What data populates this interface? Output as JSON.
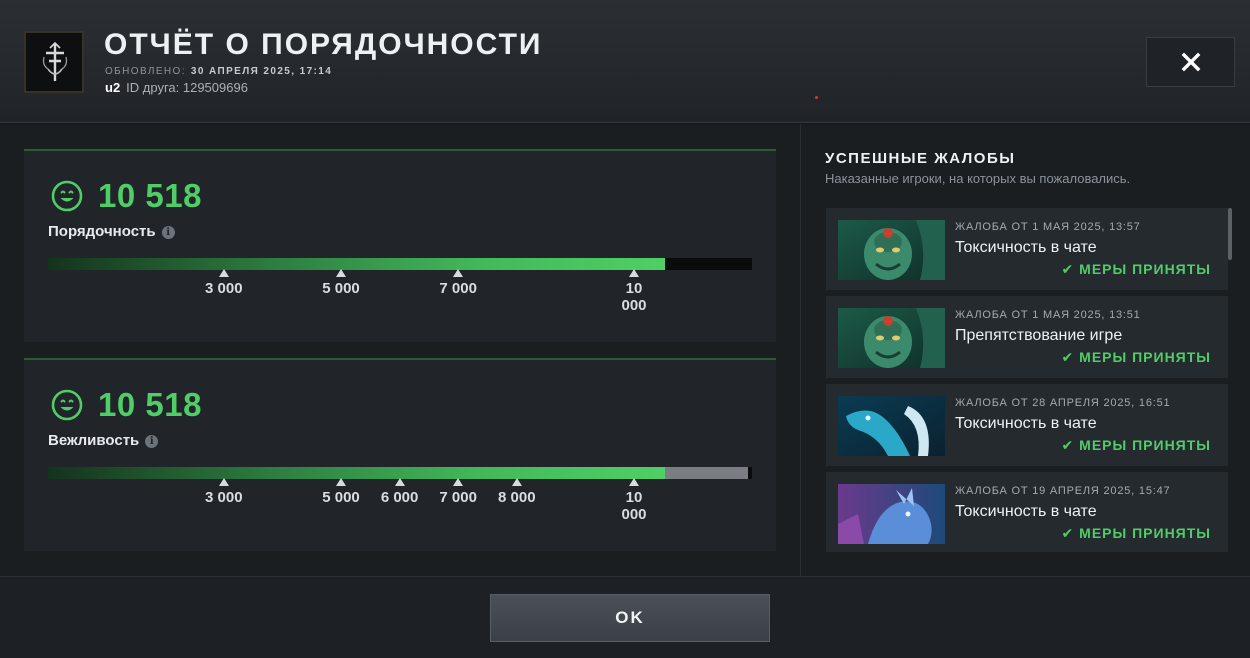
{
  "header": {
    "title": "ОТЧЁТ О ПОРЯДОЧНОСТИ",
    "updated_label": "ОБНОВЛЕНО:",
    "updated_date": "30 АПРЕЛЯ 2025, 17:14",
    "username": "u2",
    "friend_id": "ID друга: 129509696",
    "close_icon": "close-icon"
  },
  "cards": [
    {
      "score": "10 518",
      "label": "Порядочность",
      "info_icon": "i",
      "value": 10518,
      "fill_fraction": 0.876,
      "ticks": [
        {
          "label": "3 000",
          "value": 3000
        },
        {
          "label": "5 000",
          "value": 5000
        },
        {
          "label": "7 000",
          "value": 7000
        },
        {
          "label": "10 000",
          "value": 10000
        }
      ],
      "rest_color": "#0a0b0c"
    },
    {
      "score": "10 518",
      "label": "Вежливость",
      "info_icon": "i",
      "value": 10518,
      "fill_fraction": 0.876,
      "ticks": [
        {
          "label": "3 000",
          "value": 3000
        },
        {
          "label": "5 000",
          "value": 5000
        },
        {
          "label": "6 000",
          "value": 6000
        },
        {
          "label": "7 000",
          "value": 7000
        },
        {
          "label": "8 000",
          "value": 8000
        },
        {
          "label": "10 000",
          "value": 10000
        }
      ],
      "rest_color": "#7a7e82"
    }
  ],
  "reports_panel": {
    "title": "УСПЕШНЫЕ ЖАЛОБЫ",
    "subtitle": "Наказанные игроки, на которых вы пожаловались.",
    "items": [
      {
        "date": "ЖАЛОБА ОТ 1 МАЯ 2025, 13:57",
        "title": "Токсичность в чате",
        "status": "МЕРЫ ПРИНЯТЫ",
        "hero": "hero-portrait-green"
      },
      {
        "date": "ЖАЛОБА ОТ 1 МАЯ 2025, 13:51",
        "title": "Препятствование игре",
        "status": "МЕРЫ ПРИНЯТЫ",
        "hero": "hero-portrait-green"
      },
      {
        "date": "ЖАЛОБА ОТ 28 АПРЕЛЯ 2025, 16:51",
        "title": "Токсичность в чате",
        "status": "МЕРЫ ПРИНЯТЫ",
        "hero": "hero-portrait-ice"
      },
      {
        "date": "ЖАЛОБА ОТ 19 АПРЕЛЯ 2025, 15:47",
        "title": "Токсичность в чате",
        "status": "МЕРЫ ПРИНЯТЫ",
        "hero": "hero-portrait-purple"
      }
    ]
  },
  "footer": {
    "ok_label": "OK"
  },
  "colors": {
    "accent_green": "#4fce67",
    "background": "#1b1e21"
  }
}
